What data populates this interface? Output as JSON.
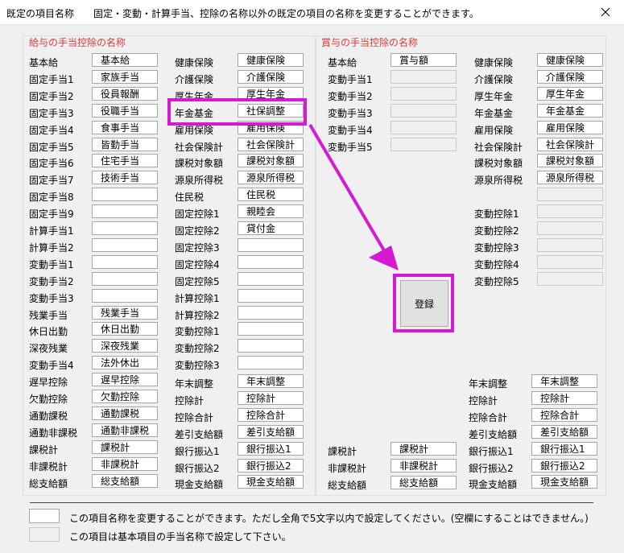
{
  "title": "既定の項目名称",
  "title_description": "固定・変動・計算手当、控除の名称以外の既定の項目の名称を変更することができます。",
  "close_icon": "close-icon",
  "salary_section_title": "給与の手当控除の名称",
  "bonus_section_title": "賞与の手当控除の名称",
  "salary_col1": [
    {
      "label": "基本給",
      "value": "基本給",
      "enabled": true
    },
    {
      "label": "固定手当1",
      "value": "家族手当",
      "enabled": true
    },
    {
      "label": "固定手当2",
      "value": "役員報酬",
      "enabled": true
    },
    {
      "label": "固定手当3",
      "value": "役職手当",
      "enabled": true
    },
    {
      "label": "固定手当4",
      "value": "食事手当",
      "enabled": true
    },
    {
      "label": "固定手当5",
      "value": "皆勤手当",
      "enabled": true
    },
    {
      "label": "固定手当6",
      "value": "住宅手当",
      "enabled": true
    },
    {
      "label": "固定手当7",
      "value": "技術手当",
      "enabled": true
    },
    {
      "label": "固定手当8",
      "value": "",
      "enabled": true
    },
    {
      "label": "固定手当9",
      "value": "",
      "enabled": true
    },
    {
      "label": "計算手当1",
      "value": "",
      "enabled": true
    },
    {
      "label": "計算手当2",
      "value": "",
      "enabled": true
    },
    {
      "label": "変動手当1",
      "value": "",
      "enabled": true
    },
    {
      "label": "変動手当2",
      "value": "",
      "enabled": true
    },
    {
      "label": "変動手当3",
      "value": "",
      "enabled": true
    },
    {
      "label": "残業手当",
      "value": "残業手当",
      "enabled": true
    },
    {
      "label": "休日出勤",
      "value": "休日出勤",
      "enabled": true
    },
    {
      "label": "深夜残業",
      "value": "深夜残業",
      "enabled": true
    },
    {
      "label": "変動手当4",
      "value": "法外休出",
      "enabled": true
    },
    {
      "label": "遅早控除",
      "value": "遅早控除",
      "enabled": true
    },
    {
      "label": "欠勤控除",
      "value": "欠勤控除",
      "enabled": true
    },
    {
      "label": "通勤課税",
      "value": "通勤課税",
      "enabled": true
    },
    {
      "label": "通勤非課税",
      "value": "通勤非課税",
      "enabled": true
    },
    {
      "label": "課税計",
      "value": "課税計",
      "enabled": true
    },
    {
      "label": "非課税計",
      "value": "非課税計",
      "enabled": true
    },
    {
      "label": "総支給額",
      "value": "総支給額",
      "enabled": true
    }
  ],
  "salary_col2_top": [
    {
      "label": "健康保険",
      "value": "健康保険",
      "enabled": true
    },
    {
      "label": "介護保険",
      "value": "介護保険",
      "enabled": true
    },
    {
      "label": "厚生年金",
      "value": "厚生年金",
      "enabled": true
    },
    {
      "label": "年金基金",
      "value": "社保調整",
      "enabled": true
    },
    {
      "label": "雇用保険",
      "value": "雇用保険",
      "enabled": true
    },
    {
      "label": "社会保険計",
      "value": "社会保険計",
      "enabled": true
    },
    {
      "label": "課税対象額",
      "value": "課税対象額",
      "enabled": true
    },
    {
      "label": "源泉所得税",
      "value": "源泉所得税",
      "enabled": true
    },
    {
      "label": "住民税",
      "value": "住民税",
      "enabled": true
    },
    {
      "label": "固定控除1",
      "value": "親睦会",
      "enabled": true
    },
    {
      "label": "固定控除2",
      "value": "貸付金",
      "enabled": true
    },
    {
      "label": "固定控除3",
      "value": "",
      "enabled": true
    },
    {
      "label": "固定控除4",
      "value": "",
      "enabled": true
    },
    {
      "label": "固定控除5",
      "value": "",
      "enabled": true
    },
    {
      "label": "計算控除1",
      "value": "",
      "enabled": true
    },
    {
      "label": "計算控除2",
      "value": "",
      "enabled": true
    },
    {
      "label": "変動控除1",
      "value": "",
      "enabled": true
    },
    {
      "label": "変動控除2",
      "value": "",
      "enabled": true
    },
    {
      "label": "変動控除3",
      "value": "",
      "enabled": true
    }
  ],
  "salary_col2_bottom": [
    {
      "label": "年末調整",
      "value": "年末調整",
      "enabled": true
    },
    {
      "label": "控除計",
      "value": "控除計",
      "enabled": true
    },
    {
      "label": "控除合計",
      "value": "控除合計",
      "enabled": true
    },
    {
      "label": "差引支給額",
      "value": "差引支給額",
      "enabled": true
    },
    {
      "label": "銀行振込1",
      "value": "銀行振込1",
      "enabled": true
    },
    {
      "label": "銀行振込2",
      "value": "銀行振込2",
      "enabled": true
    },
    {
      "label": "現金支給額",
      "value": "現金支給額",
      "enabled": true
    }
  ],
  "bonus_col1_top": [
    {
      "label": "基本給",
      "value": "賞与額",
      "enabled": true
    },
    {
      "label": "変動手当1",
      "value": "",
      "enabled": false
    },
    {
      "label": "変動手当2",
      "value": "",
      "enabled": false
    },
    {
      "label": "変動手当3",
      "value": "",
      "enabled": false
    },
    {
      "label": "変動手当4",
      "value": "",
      "enabled": false
    },
    {
      "label": "変動手当5",
      "value": "",
      "enabled": false
    }
  ],
  "bonus_col1_bottom": [
    {
      "label": "課税計",
      "value": "課税計",
      "enabled": true
    },
    {
      "label": "非課税計",
      "value": "非課税計",
      "enabled": true
    },
    {
      "label": "総支給額",
      "value": "総支給額",
      "enabled": true
    }
  ],
  "bonus_col2_top": [
    {
      "label": "健康保険",
      "value": "健康保険",
      "enabled": true
    },
    {
      "label": "介護保険",
      "value": "介護保険",
      "enabled": true
    },
    {
      "label": "厚生年金",
      "value": "厚生年金",
      "enabled": true
    },
    {
      "label": "年金基金",
      "value": "年金基金",
      "enabled": true
    },
    {
      "label": "雇用保険",
      "value": "雇用保険",
      "enabled": true
    },
    {
      "label": "社会保険計",
      "value": "社会保険計",
      "enabled": true
    },
    {
      "label": "課税対象額",
      "value": "課税対象額",
      "enabled": true
    },
    {
      "label": "源泉所得税",
      "value": "源泉所得税",
      "enabled": true
    },
    {
      "label": "",
      "value": "",
      "enabled": false
    },
    {
      "label": "変動控除1",
      "value": "",
      "enabled": false
    },
    {
      "label": "変動控除2",
      "value": "",
      "enabled": false
    },
    {
      "label": "変動控除3",
      "value": "",
      "enabled": false
    },
    {
      "label": "変動控除4",
      "value": "",
      "enabled": false
    },
    {
      "label": "変動控除5",
      "value": "",
      "enabled": false
    }
  ],
  "bonus_col2_bottom": [
    {
      "label": "年末調整",
      "value": "年末調整",
      "enabled": true
    },
    {
      "label": "控除計",
      "value": "控除計",
      "enabled": true
    },
    {
      "label": "控除合計",
      "value": "控除合計",
      "enabled": true
    },
    {
      "label": "差引支給額",
      "value": "差引支給額",
      "enabled": true
    },
    {
      "label": "銀行振込1",
      "value": "銀行振込1",
      "enabled": true
    },
    {
      "label": "銀行振込2",
      "value": "銀行振込2",
      "enabled": true
    },
    {
      "label": "現金支給額",
      "value": "現金支給額",
      "enabled": true
    }
  ],
  "register_button": "登録",
  "legend": {
    "editable": "この項目名称を変更することができます。ただし全角で5文字以内で設定してください。(空欄にすることはできません。)",
    "fixed": "この項目は基本項目の手当名称で設定して下さい。"
  },
  "colors": {
    "section_title": "#e03a3a",
    "highlight": "#d41ad3",
    "disabled_field": "#f0f0f0"
  }
}
